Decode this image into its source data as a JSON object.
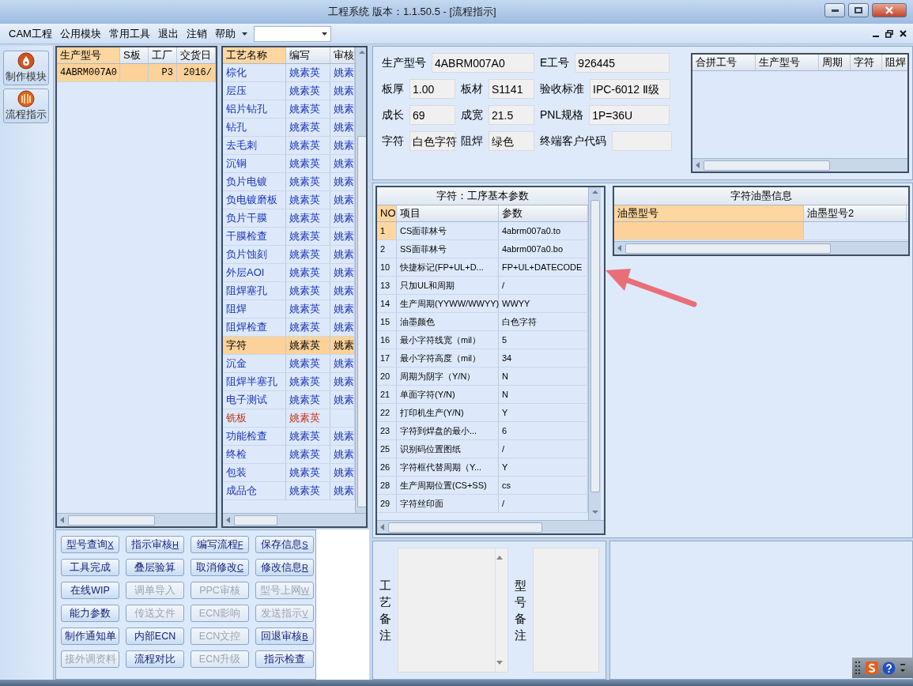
{
  "window": {
    "title": "工程系统   版本：1.1.50.5 - [流程指示]"
  },
  "menu": {
    "items": [
      "CAM工程",
      "公用模块",
      "常用工具",
      "退出",
      "注销",
      "帮助"
    ]
  },
  "nav": {
    "items": [
      "制作模块",
      "流程指示"
    ]
  },
  "orders": {
    "columns": [
      "生产型号",
      "S板",
      "工厂",
      "交货日"
    ],
    "rows": [
      {
        "model": "4ABRM007A0",
        "factory": "P3",
        "delivery": "2016/",
        "selected": true
      }
    ]
  },
  "processes": {
    "columns": [
      "工艺名称",
      "编写",
      "审核"
    ],
    "rows": [
      {
        "name": "棕化",
        "author": "姚素英",
        "reviewer": "姚素",
        "selected": false,
        "flagged": false
      },
      {
        "name": "层压",
        "author": "姚素英",
        "reviewer": "姚素",
        "selected": false,
        "flagged": false
      },
      {
        "name": "铝片钻孔",
        "author": "姚素英",
        "reviewer": "姚素",
        "selected": false,
        "flagged": false
      },
      {
        "name": "钻孔",
        "author": "姚素英",
        "reviewer": "姚素",
        "selected": false,
        "flagged": false
      },
      {
        "name": "去毛刺",
        "author": "姚素英",
        "reviewer": "姚素",
        "selected": false,
        "flagged": false
      },
      {
        "name": "沉铜",
        "author": "姚素英",
        "reviewer": "姚素",
        "selected": false,
        "flagged": false
      },
      {
        "name": "负片电镀",
        "author": "姚素英",
        "reviewer": "姚素",
        "selected": false,
        "flagged": false
      },
      {
        "name": "负电镀磨板",
        "author": "姚素英",
        "reviewer": "姚素",
        "selected": false,
        "flagged": false
      },
      {
        "name": "负片干膜",
        "author": "姚素英",
        "reviewer": "姚素",
        "selected": false,
        "flagged": false
      },
      {
        "name": "干膜检查",
        "author": "姚素英",
        "reviewer": "姚素",
        "selected": false,
        "flagged": false
      },
      {
        "name": "负片蚀刻",
        "author": "姚素英",
        "reviewer": "姚素",
        "selected": false,
        "flagged": false
      },
      {
        "name": "外层AOI",
        "author": "姚素英",
        "reviewer": "姚素",
        "selected": false,
        "flagged": false
      },
      {
        "name": "阻焊塞孔",
        "author": "姚素英",
        "reviewer": "姚素",
        "selected": false,
        "flagged": false
      },
      {
        "name": "阻焊",
        "author": "姚素英",
        "reviewer": "姚素",
        "selected": false,
        "flagged": false
      },
      {
        "name": "阻焊检查",
        "author": "姚素英",
        "reviewer": "姚素",
        "selected": false,
        "flagged": false
      },
      {
        "name": "字符",
        "author": "姚素英",
        "reviewer": "姚素",
        "selected": true,
        "flagged": false
      },
      {
        "name": "沉金",
        "author": "姚素英",
        "reviewer": "姚素",
        "selected": false,
        "flagged": false
      },
      {
        "name": "阻焊半塞孔",
        "author": "姚素英",
        "reviewer": "姚素",
        "selected": false,
        "flagged": false
      },
      {
        "name": "电子测试",
        "author": "姚素英",
        "reviewer": "姚素",
        "selected": false,
        "flagged": false
      },
      {
        "name": "铣板",
        "author": "姚素英",
        "selected": false,
        "flagged": true
      },
      {
        "name": "功能检查",
        "author": "姚素英",
        "reviewer": "姚素",
        "selected": false,
        "flagged": false
      },
      {
        "name": "终检",
        "author": "姚素英",
        "reviewer": "姚素",
        "selected": false,
        "flagged": false
      },
      {
        "name": "包装",
        "author": "姚素英",
        "reviewer": "姚素",
        "selected": false,
        "flagged": false
      },
      {
        "name": "成品仓",
        "author": "姚素英",
        "reviewer": "姚素",
        "selected": false,
        "flagged": false
      }
    ]
  },
  "buttons": [
    {
      "label": "型号查询",
      "key": "X",
      "disabled": false
    },
    {
      "label": "指示审核",
      "key": "H",
      "disabled": false
    },
    {
      "label": "编写流程",
      "key": "F",
      "disabled": false
    },
    {
      "label": "保存信息",
      "key": "S",
      "disabled": false
    },
    {
      "label": "工具完成",
      "disabled": false
    },
    {
      "label": "叠层验算",
      "disabled": false
    },
    {
      "label": "取消修改",
      "key": "C",
      "disabled": false
    },
    {
      "label": "修改信息",
      "key": "R",
      "disabled": false
    },
    {
      "label": "在线WIP",
      "disabled": false
    },
    {
      "label": "调单导入",
      "disabled": true
    },
    {
      "label": "PPC审核",
      "disabled": true
    },
    {
      "label": "型号上网",
      "key": "W",
      "disabled": true
    },
    {
      "label": "能力参数",
      "disabled": false
    },
    {
      "label": "传送文件",
      "disabled": true
    },
    {
      "label": "ECN影响",
      "disabled": true
    },
    {
      "label": "发送指示",
      "key": "V",
      "disabled": true
    },
    {
      "label": "制作通知单",
      "disabled": false
    },
    {
      "label": "内部ECN",
      "disabled": false
    },
    {
      "label": "ECN文控",
      "disabled": true
    },
    {
      "label": "回退审核",
      "key": "B",
      "disabled": false
    },
    {
      "label": "接外调资料",
      "disabled": true
    },
    {
      "label": "流程对比",
      "disabled": false
    },
    {
      "label": "ECN升级",
      "disabled": true
    },
    {
      "label": "指示检查",
      "disabled": false
    }
  ],
  "info": {
    "fields": [
      {
        "label": "生产型号",
        "value": "4ABRM007A0"
      },
      {
        "label": "E工号",
        "value": "926445"
      },
      {
        "label": "板厚",
        "value": "1.00"
      },
      {
        "label": "板材",
        "value": "S1141"
      },
      {
        "label": "验收标准",
        "value": "IPC-6012 Ⅱ级"
      },
      {
        "label": "成长",
        "value": "69"
      },
      {
        "label": "成宽",
        "value": "21.5"
      },
      {
        "label": "PNL规格",
        "value": "1P=36U"
      },
      {
        "label": "字符",
        "value": "白色字符"
      },
      {
        "label": "阻焊",
        "value": "绿色"
      },
      {
        "label": "终端客户代码"
      }
    ]
  },
  "merge_grid": {
    "columns": [
      "合拼工号",
      "生产型号",
      "周期",
      "字符",
      "阻焊"
    ]
  },
  "params": {
    "title": "字符：工序基本参数",
    "columns": [
      "NO",
      "项目",
      "参数"
    ],
    "rows": [
      {
        "no": "1",
        "item": "CS面菲林号",
        "value": "4abrm007a0.to",
        "selected": true
      },
      {
        "no": "2",
        "item": "SS面菲林号",
        "value": "4abrm007a0.bo",
        "selected": false
      },
      {
        "no": "10",
        "item": "快捷标记(FP+UL+D...",
        "value": "FP+UL+DATECODE",
        "selected": false
      },
      {
        "no": "13",
        "item": "只加UL和周期",
        "value": "/",
        "selected": false
      },
      {
        "no": "14",
        "item": "生产周期(YYWW/WWYY)",
        "value": "WWYY",
        "selected": false
      },
      {
        "no": "15",
        "item": "油墨颜色",
        "value": "白色字符",
        "selected": false
      },
      {
        "no": "16",
        "item": "最小字符线宽（mil）",
        "value": "5",
        "selected": false
      },
      {
        "no": "17",
        "item": "最小字符高度（mil）",
        "value": "34",
        "selected": false
      },
      {
        "no": "20",
        "item": "周期为阴字（Y/N）",
        "value": "N",
        "selected": false
      },
      {
        "no": "21",
        "item": "单面字符(Y/N)",
        "value": "N",
        "selected": false
      },
      {
        "no": "22",
        "item": "打印机生产(Y/N)",
        "value": "Y",
        "selected": false
      },
      {
        "no": "23",
        "item": "字符到焊盘的最小...",
        "value": "6",
        "selected": false
      },
      {
        "no": "25",
        "item": "识别码位置图纸",
        "value": "/",
        "selected": false
      },
      {
        "no": "26",
        "item": "字符框代替周期（Y...",
        "value": "Y",
        "selected": false
      },
      {
        "no": "28",
        "item": "生产周期位置(CS+SS)",
        "value": "cs",
        "selected": false
      },
      {
        "no": "29",
        "item": "字符丝印面",
        "value": "/",
        "selected": false
      }
    ]
  },
  "ink": {
    "title": "字符油墨信息",
    "columns": [
      "油墨型号",
      "油墨型号2"
    ],
    "rows": [
      {
        "selected": true
      }
    ]
  },
  "remarks": [
    {
      "label": "工艺备注"
    },
    {
      "label": "型号备注"
    }
  ]
}
